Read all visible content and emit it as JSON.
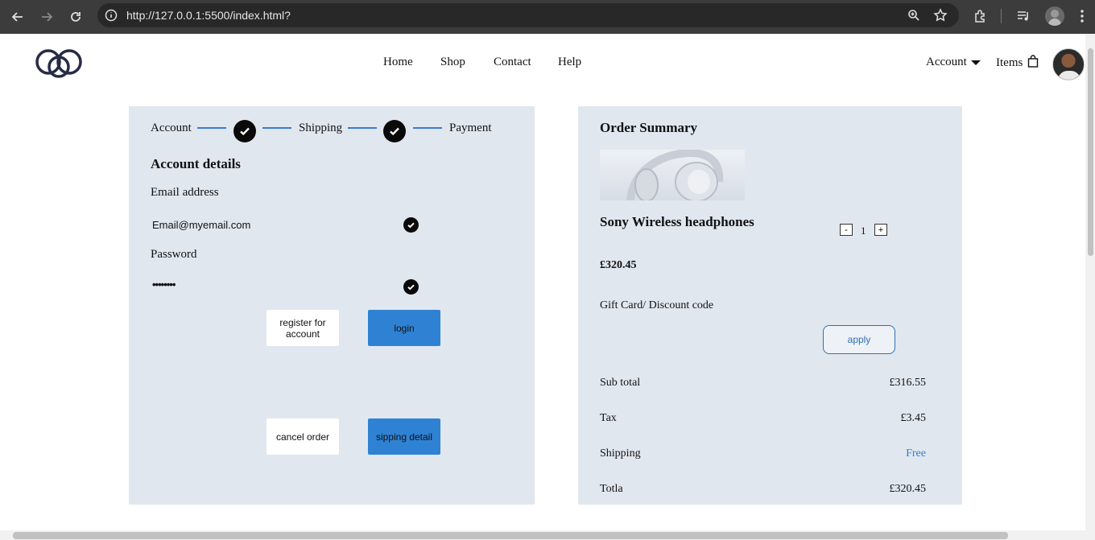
{
  "browser": {
    "url": "http://127.0.0.1:5500/index.html?"
  },
  "header": {
    "nav": [
      "Home",
      "Shop",
      "Contact",
      "Help"
    ],
    "account_label": "Account",
    "items_label": "Items"
  },
  "steps": {
    "account": "Account",
    "shipping": "Shipping",
    "payment": "Payment"
  },
  "account_details": {
    "title": "Account details",
    "email_label": "Email address",
    "email_value": "Email@myemail.com",
    "password_label": "Password",
    "password_value": "••••••••",
    "register_button": "register for account",
    "login_button": "login",
    "cancel_button": "cancel order",
    "shipping_button": "sipping detail"
  },
  "order_summary": {
    "title": "Order Summary",
    "product_name": "Sony Wireless headphones",
    "quantity": "1",
    "minus": "-",
    "plus": "+",
    "price": "£320.45",
    "discount_label": "Gift Card/ Discount code",
    "apply_button": "apply",
    "rows": [
      {
        "label": "Sub total",
        "value": "£316.55"
      },
      {
        "label": "Tax",
        "value": "£3.45"
      },
      {
        "label": "Shipping",
        "value": "Free"
      },
      {
        "label": "Totla",
        "value": "£320.45"
      }
    ]
  },
  "colors": {
    "accent": "#2f82d3",
    "panel": "#e1e7ef"
  }
}
